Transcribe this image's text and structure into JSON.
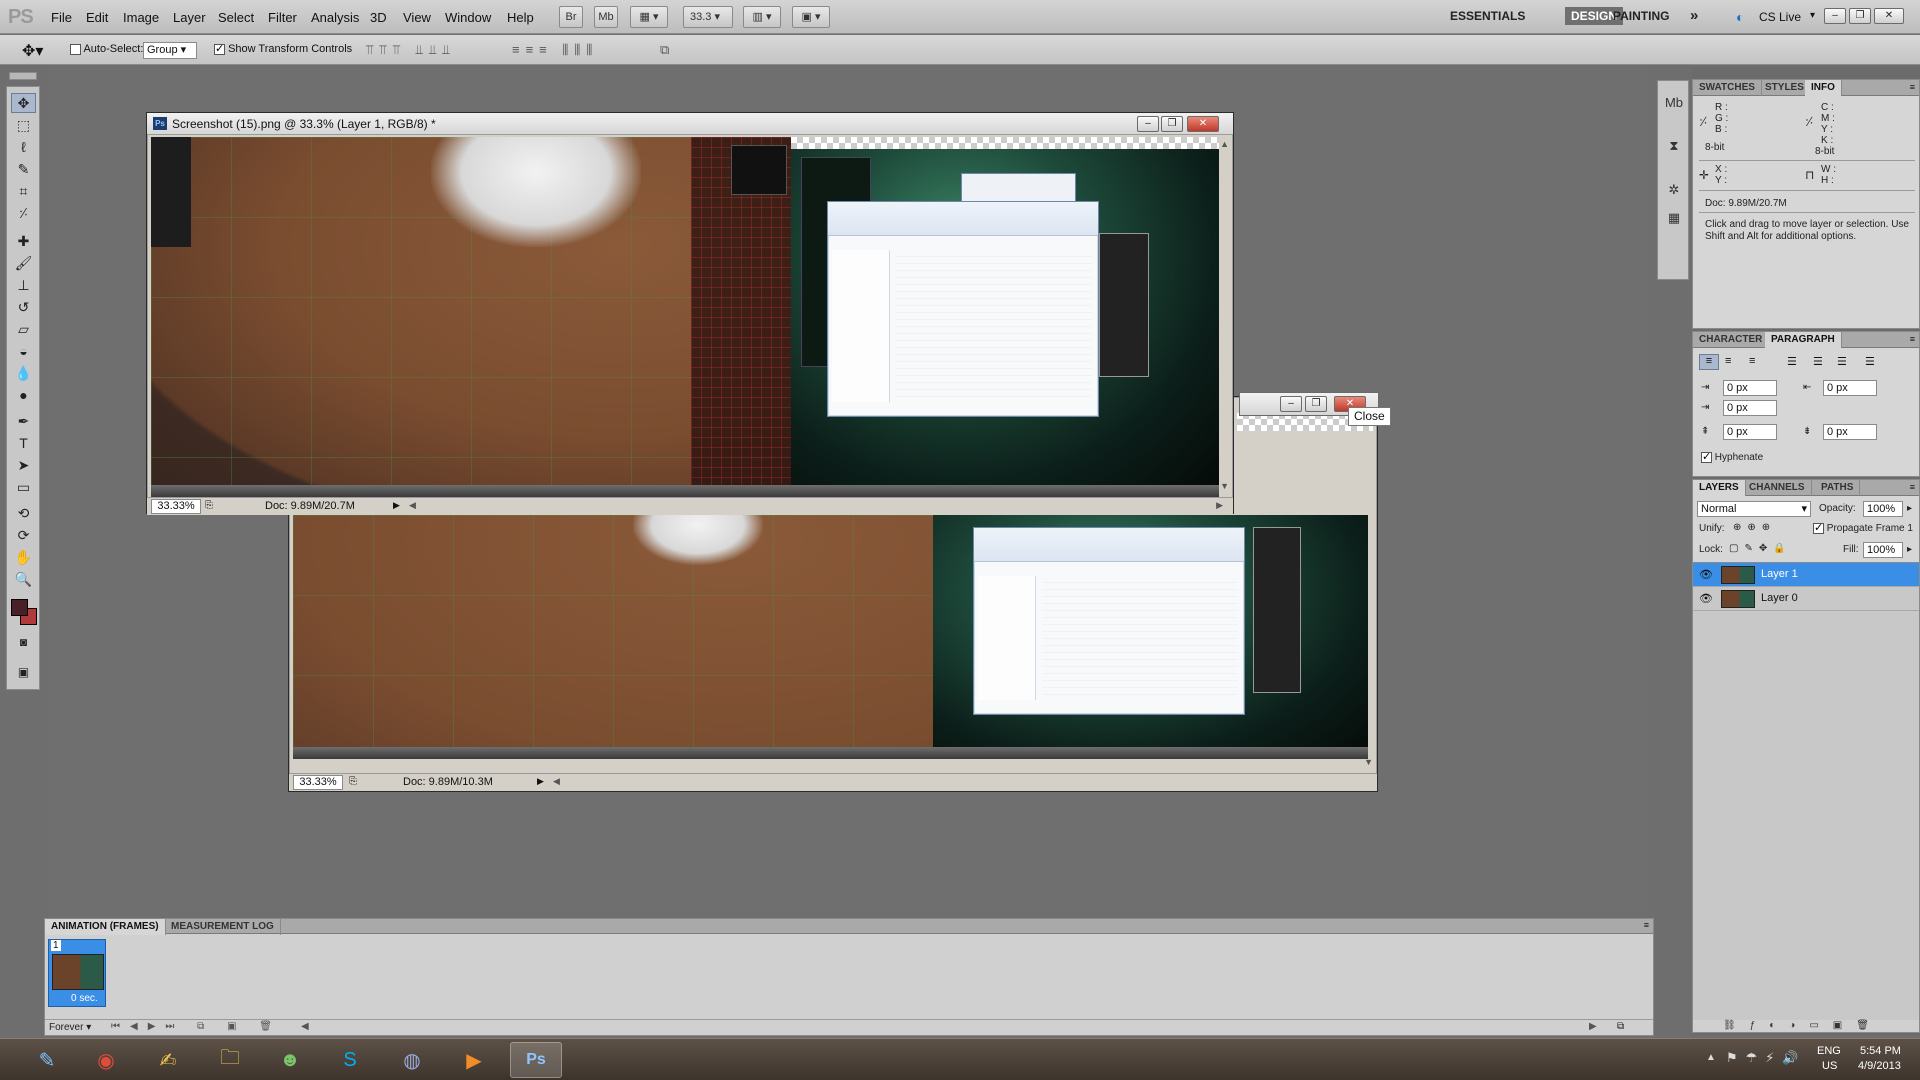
{
  "app": {
    "logo": "PS"
  },
  "menu": [
    "File",
    "Edit",
    "Image",
    "Layer",
    "Select",
    "Filter",
    "Analysis",
    "3D",
    "View",
    "Window",
    "Help"
  ],
  "toolbar": {
    "br": "Br",
    "mb": "Mb",
    "zoom": "33.3"
  },
  "workspaces": {
    "essentials": "ESSENTIALS",
    "design": "DESIGN",
    "painting": "PAINTING",
    "more": "»",
    "cslive": "CS Live"
  },
  "options": {
    "auto_select_label": "Auto-Select:",
    "auto_select_value": "Group",
    "show_transform_label": "Show Transform Controls"
  },
  "doc1": {
    "title": "Screenshot (15).png @ 33.3% (Layer 1, RGB/8) *",
    "zoom": "33.33%",
    "doc_size": "Doc: 9.89M/20.7M"
  },
  "doc2": {
    "zoom": "33.33%",
    "doc_size": "Doc: 9.89M/10.3M"
  },
  "tooltip": "Close",
  "info_panel": {
    "tabs": [
      "SWATCHES",
      "STYLES",
      "INFO"
    ],
    "r": "R :",
    "g": "G :",
    "b": "B :",
    "c": "C :",
    "m": "M :",
    "y": "Y :",
    "k": "K :",
    "bit_left": "8-bit",
    "bit_right": "8-bit",
    "x": "X :",
    "y2": "Y :",
    "w": "W :",
    "h": "H :",
    "doc": "Doc: 9.89M/20.7M",
    "hint": "Click and drag to move layer or selection. Use Shift and Alt for additional options."
  },
  "paragraph_panel": {
    "tabs": [
      "CHARACTER",
      "PARAGRAPH"
    ],
    "indent_left": "0 px",
    "indent_right": "0 px",
    "indent_first": "0 px",
    "space_before": "0 px",
    "space_after": "0 px",
    "hyphenate": "Hyphenate"
  },
  "layers_panel": {
    "tabs": [
      "LAYERS",
      "CHANNELS",
      "PATHS"
    ],
    "blend_mode": "Normal",
    "opacity_label": "Opacity:",
    "opacity": "100%",
    "unify_label": "Unify:",
    "propagate": "Propagate Frame 1",
    "lock_label": "Lock:",
    "fill_label": "Fill:",
    "fill": "100%",
    "layers": [
      {
        "name": "Layer 1",
        "selected": true
      },
      {
        "name": "Layer 0",
        "selected": false
      }
    ]
  },
  "animation": {
    "tabs": [
      "ANIMATION (FRAMES)",
      "MEASUREMENT LOG"
    ],
    "frame_number": "1",
    "frame_delay": "0 sec.",
    "loop": "Forever"
  },
  "taskbar": {
    "lang": "ENG",
    "region": "US",
    "time": "5:54 PM",
    "date": "4/9/2013"
  }
}
